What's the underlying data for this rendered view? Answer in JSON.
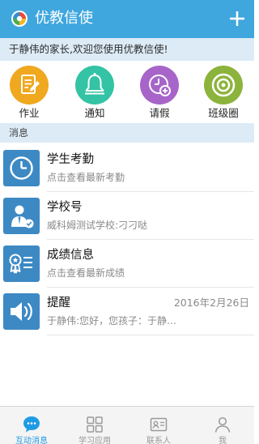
{
  "header": {
    "title": "优教信使",
    "add_label": "+"
  },
  "welcome": {
    "text": "于静伟的家长,欢迎您使用优教信使!"
  },
  "shortcuts": [
    {
      "label": "作业",
      "icon": "homework-icon",
      "color": "#f0a81f"
    },
    {
      "label": "通知",
      "icon": "bell-icon",
      "color": "#34c3a4"
    },
    {
      "label": "请假",
      "icon": "leave-clock-icon",
      "color": "#a765c9"
    },
    {
      "label": "班级圈",
      "icon": "class-circle-icon",
      "color": "#8cb33b"
    }
  ],
  "section": {
    "title": "消息"
  },
  "messages": [
    {
      "title": "学生考勤",
      "subtitle": "点击查看最新考勤",
      "time": "",
      "icon": "clock-icon"
    },
    {
      "title": "学校号",
      "subtitle": "威科姆测试学校:刁刁哒",
      "time": "",
      "icon": "school-id-icon"
    },
    {
      "title": "成绩信息",
      "subtitle": "点击查看最新成绩",
      "time": "",
      "icon": "grade-award-icon"
    },
    {
      "title": "提醒",
      "subtitle": "于静伟:您好，您孩子：于静…",
      "time": "2016年2月26日",
      "icon": "speaker-icon"
    }
  ],
  "tabs": [
    {
      "label": "互动消息",
      "icon": "chat-bubble-icon",
      "active": true
    },
    {
      "label": "学习应用",
      "icon": "apps-grid-icon",
      "active": false
    },
    {
      "label": "联系人",
      "icon": "contact-card-icon",
      "active": false
    },
    {
      "label": "我",
      "icon": "person-icon",
      "active": false
    }
  ],
  "colors": {
    "brand": "#3fa6de",
    "message_icon": "#3d89c4",
    "active_tab": "#1f9be5"
  }
}
